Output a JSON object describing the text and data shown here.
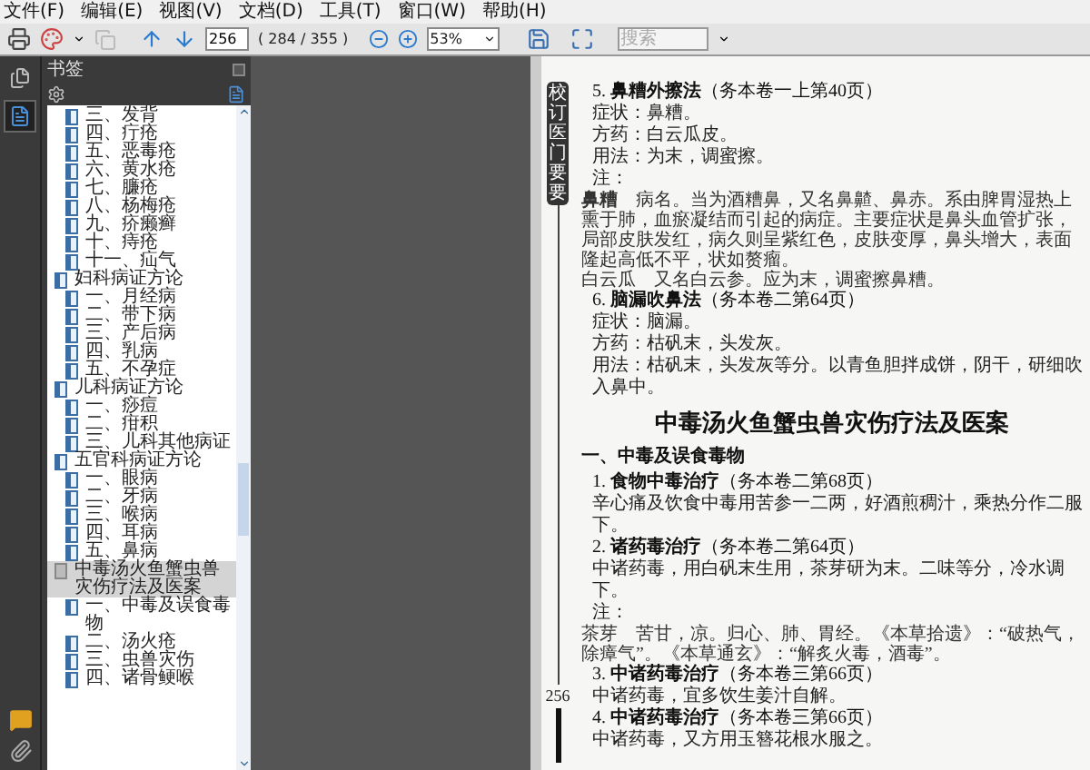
{
  "menu": [
    "文件(F)",
    "编辑(E)",
    "视图(V)",
    "文档(D)",
    "工具(T)",
    "窗口(W)",
    "帮助(H)"
  ],
  "toolbar": {
    "page_input": "256",
    "page_count": "( 284 / 355 )",
    "zoom": "53%",
    "search_placeholder": "搜索"
  },
  "nav_strip": [
    {
      "kind": "pages",
      "selected": false
    },
    {
      "kind": "bookmarks",
      "selected": true
    }
  ],
  "bookmarks": {
    "title": "书签",
    "items": [
      {
        "label": "三、发背",
        "selected": false,
        "kind": "sub"
      },
      {
        "label": "四、疔疮",
        "selected": false,
        "kind": "sub"
      },
      {
        "label": "五、恶毒疮",
        "selected": false,
        "kind": "sub"
      },
      {
        "label": "六、黄水疮",
        "selected": false,
        "kind": "sub"
      },
      {
        "label": "七、臁疮",
        "selected": false,
        "kind": "sub"
      },
      {
        "label": "八、杨梅疮",
        "selected": false,
        "kind": "sub"
      },
      {
        "label": "九、疥癞癣",
        "selected": false,
        "kind": "sub"
      },
      {
        "label": "十、痔疮",
        "selected": false,
        "kind": "sub"
      },
      {
        "label": "十一、疝气",
        "selected": false,
        "kind": "sub"
      },
      {
        "label": "妇科病证方论",
        "selected": false,
        "children": [
          {
            "label": "一、月经病",
            "selected": false
          },
          {
            "label": "二、带下病",
            "selected": false
          },
          {
            "label": "三、产后病",
            "selected": false
          },
          {
            "label": "四、乳病",
            "selected": false
          },
          {
            "label": "五、不孕症",
            "selected": false
          }
        ]
      },
      {
        "label": "儿科病证方论",
        "selected": false,
        "children": [
          {
            "label": "一、痧痘",
            "selected": false
          },
          {
            "label": "二、疳积",
            "selected": false
          },
          {
            "label": "三、儿科其他病证",
            "selected": false
          }
        ]
      },
      {
        "label": "五官科病证方论",
        "selected": false,
        "children": [
          {
            "label": "一、眼病",
            "selected": false
          },
          {
            "label": "二、牙病",
            "selected": false
          },
          {
            "label": "三、喉病",
            "selected": false
          },
          {
            "label": "四、耳病",
            "selected": false
          },
          {
            "label": "五、鼻病",
            "selected": false
          }
        ]
      },
      {
        "label": "中毒汤火鱼蟹虫兽灾伤疗法及医案",
        "selected": true,
        "children": [
          {
            "label": "一、中毒及误食毒物",
            "selected": false
          },
          {
            "label": "二、汤火疮",
            "selected": false
          },
          {
            "label": "三、虫兽灾伤",
            "selected": false
          },
          {
            "label": "四、诸骨鲠喉",
            "selected": false
          }
        ]
      }
    ]
  },
  "page": {
    "side_tab": "校订医门要要",
    "page_number": "256",
    "blocks": [
      {
        "kind": "item",
        "text": "5. **鼻糟外擦法**（务本卷一上第40页）"
      },
      {
        "kind": "text",
        "text": "症状：鼻糟。"
      },
      {
        "kind": "text",
        "text": "方药：白云瓜皮。"
      },
      {
        "kind": "text",
        "text": "用法：为末，调蜜擦。"
      },
      {
        "kind": "text",
        "text": "注："
      },
      {
        "kind": "note",
        "text": "**鼻糟**　病名。当为酒糟鼻，又名鼻齄、鼻赤。系由脾胃湿热上熏于肺，血瘀凝结而引起的病症。主要症状是鼻头血管扩张，局部皮肤发红，病久则呈紫红色，皮肤变厚，鼻头增大，表面隆起高低不平，状如赘瘤。"
      },
      {
        "kind": "note",
        "text": "白云瓜　又名白云参。应为末，调蜜擦鼻糟。"
      },
      {
        "kind": "item",
        "text": "6. **脑漏吹鼻法**（务本卷二第64页）"
      },
      {
        "kind": "text",
        "text": "症状：脑漏。"
      },
      {
        "kind": "text",
        "text": "方药：枯矾末，头发灰。"
      },
      {
        "kind": "text",
        "text": "用法：枯矾末，头发灰等分。以青鱼胆拌成饼，阴干，研细吹入鼻中。"
      },
      {
        "kind": "heading",
        "text": "中毒汤火鱼蟹虫兽灾伤疗法及医案"
      },
      {
        "kind": "section",
        "text": "一、中毒及误食毒物"
      },
      {
        "kind": "item",
        "text": "1. **食物中毒治疗**（务本卷二第68页）"
      },
      {
        "kind": "text",
        "text": "辛心痛及饮食中毒用苦参一二两，好酒煎稠汁，乘热分作二服下。"
      },
      {
        "kind": "item",
        "text": "2. **诸药毒治疗**（务本卷二第64页）"
      },
      {
        "kind": "text",
        "text": "中诸药毒，用白矾末生用，茶芽研为末。二味等分，冷水调下。"
      },
      {
        "kind": "text",
        "text": "注："
      },
      {
        "kind": "note",
        "text": "茶芽　苦甘，凉。归心、肺、胃经。《本草拾遗》：“破热气，除瘴气”。《本草通玄》：“解炙火毒，酒毒”。"
      },
      {
        "kind": "item",
        "text": "3. **中诸药毒治疗**（务本卷三第66页）"
      },
      {
        "kind": "text",
        "text": "中诸药毒，宜多饮生姜汁自解。"
      },
      {
        "kind": "item",
        "text": "4. **中诸药毒治疗**（务本卷三第66页）"
      },
      {
        "kind": "text",
        "text": "中诸药毒，又方用玉簪花根水服之。"
      }
    ]
  }
}
